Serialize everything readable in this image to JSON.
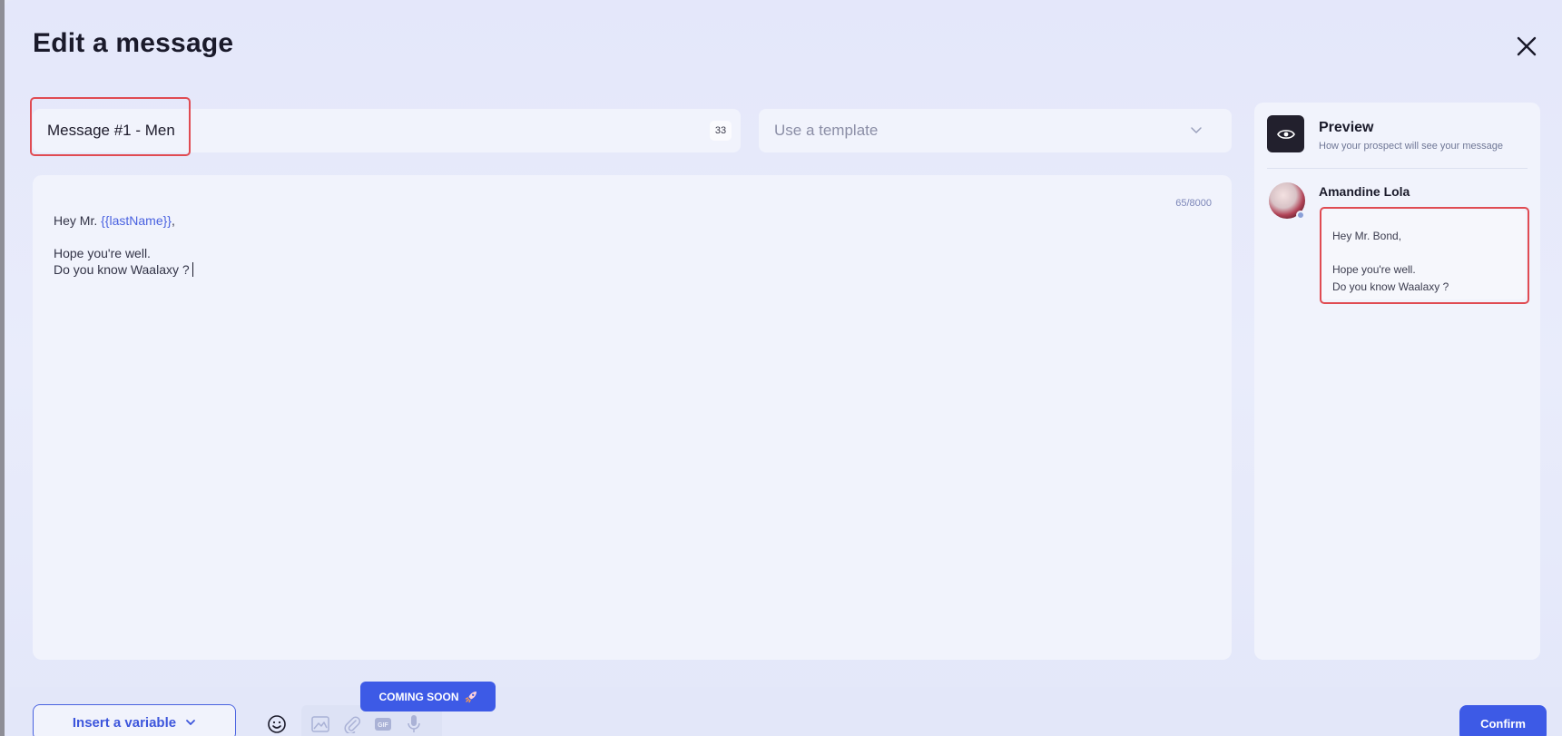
{
  "dialog": {
    "title": "Edit a message"
  },
  "message_name": {
    "value": "Message #1 - Men",
    "char_count": "33"
  },
  "template": {
    "placeholder": "Use a template"
  },
  "editor": {
    "char_count": "65/8000",
    "lines": {
      "greeting_prefix": "Hey Mr. ",
      "greeting_variable": "{{lastName}}",
      "greeting_suffix": ",",
      "line_2": "Hope you're well.",
      "line_3": "Do you know Waalaxy ?"
    }
  },
  "preview": {
    "title": "Preview",
    "subtitle": "How your prospect will see your message",
    "sender_name": "Amandine Lola",
    "lines": {
      "line_1": "Hey Mr. Bond,",
      "line_2": "Hope you're well.",
      "line_3": "Do you know Waalaxy ?"
    }
  },
  "toolbar": {
    "insert_variable_label": "Insert a variable",
    "coming_soon_label": "COMING SOON",
    "confirm_label": "Confirm",
    "tools": [
      "image-icon",
      "paperclip-icon",
      "gif-icon",
      "microphone-icon"
    ]
  },
  "colors": {
    "accent": "#3d5ae6",
    "highlight": "#e04b52",
    "variable": "#4a62e0"
  }
}
